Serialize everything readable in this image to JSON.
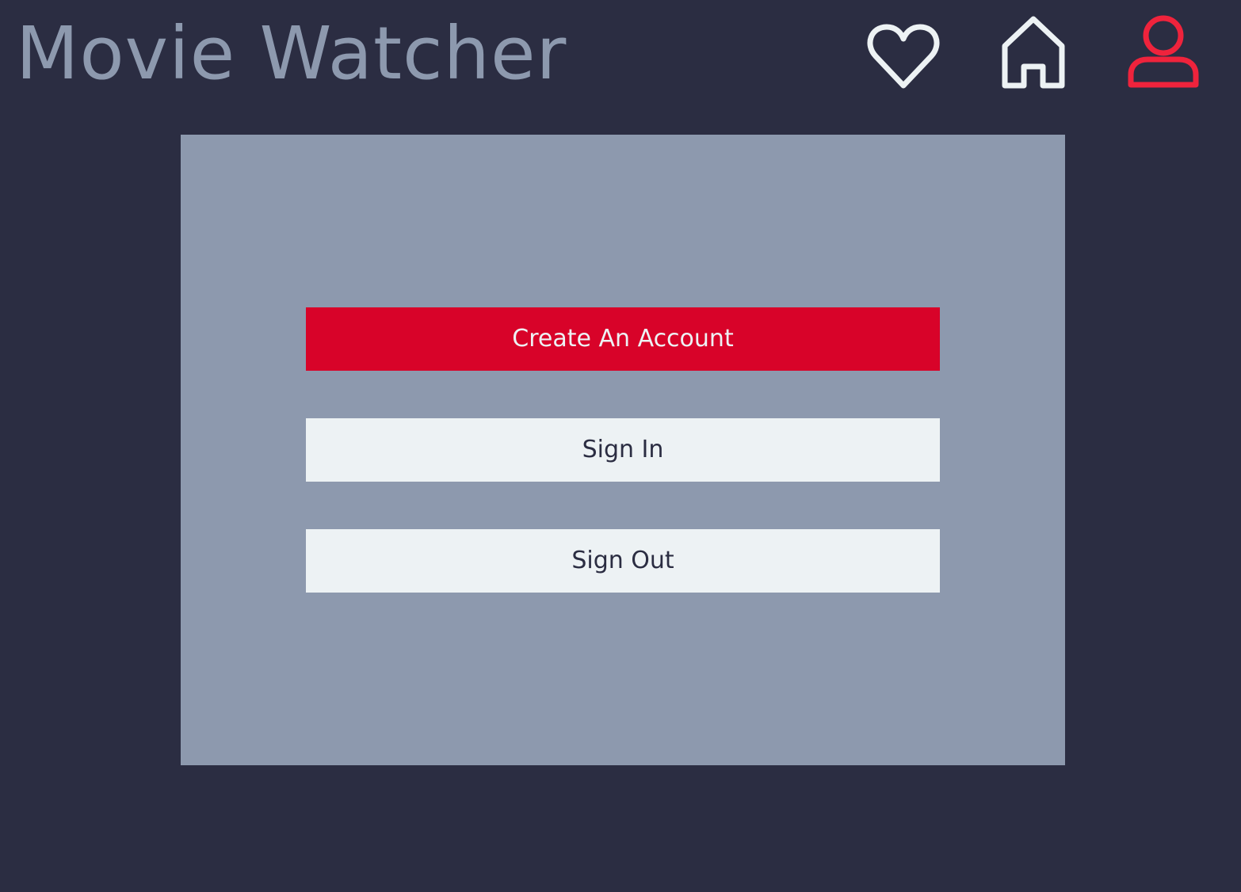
{
  "header": {
    "title": "Movie Watcher",
    "nav": [
      {
        "name": "favorites",
        "icon": "heart-icon",
        "color": "#edf2f4"
      },
      {
        "name": "home",
        "icon": "home-icon",
        "color": "#edf2f4"
      },
      {
        "name": "account",
        "icon": "user-icon",
        "color": "#ef233c",
        "active": true
      }
    ]
  },
  "account_panel": {
    "create_account_label": "Create An Account",
    "sign_in_label": "Sign In",
    "sign_out_label": "Sign Out"
  },
  "colors": {
    "background": "#2b2d42",
    "title": "#8d99ae",
    "panel": "#8d99ae",
    "primary_button": "#d80329",
    "secondary_button": "#edf2f4",
    "active_icon": "#ef233c",
    "icon": "#edf2f4"
  }
}
